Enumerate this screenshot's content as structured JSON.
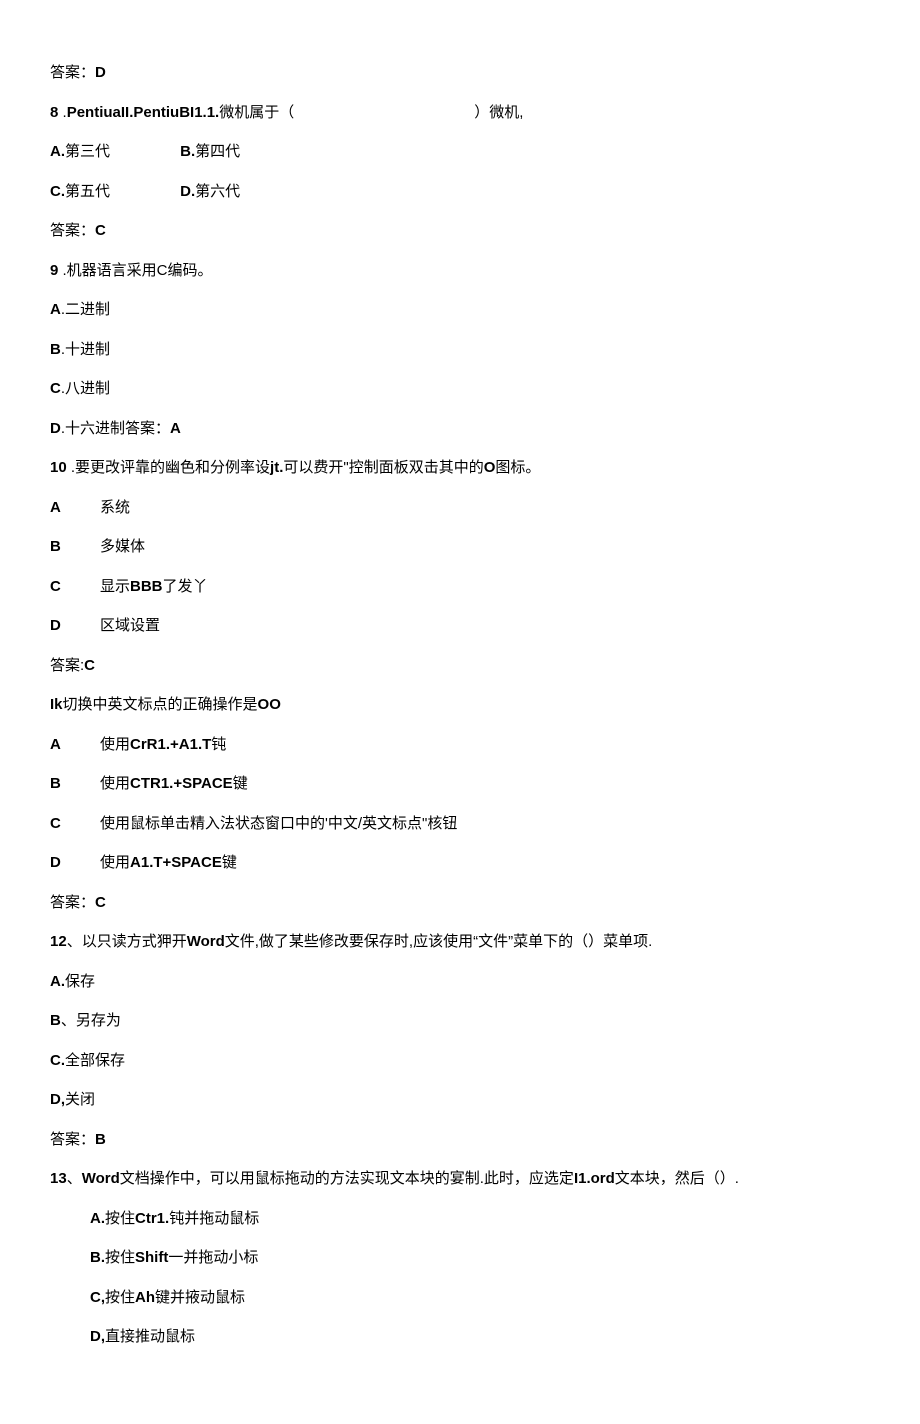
{
  "ans7": {
    "label": "答案：",
    "val": "D"
  },
  "q8": {
    "num": "8",
    "dot": " .",
    "stem_bold": "PentiuaII.PentiuBI1.1.",
    "stem_rest_1": "微机属于（",
    "stem_rest_2": "）微机,",
    "optA": {
      "label": "A.",
      "text": "第三代"
    },
    "optB": {
      "label": "B.",
      "text": "第四代"
    },
    "optC": {
      "label": "C.",
      "text": "第五代"
    },
    "optD": {
      "label": "D.",
      "text": "第六代"
    },
    "ans": {
      "label": "答案：",
      "val": "C"
    }
  },
  "q9": {
    "num": "9",
    "dot": " .机器语言采用C编码。",
    "optA": {
      "label": "A",
      "text": ".二进制"
    },
    "optB": {
      "label": "B",
      "text": ".十进制"
    },
    "optC": {
      "label": "C",
      "text": ".八进制"
    },
    "optD": {
      "label": "D",
      "text": ".十六进制答案：",
      "val": "A"
    }
  },
  "q10": {
    "num": "10",
    "stem_1": " .要更改评靠的幽色和分例率设",
    "stem_bold": "jt.",
    "stem_2": "可以费开\"控制面板双击其中的",
    "stem_bold2": "O",
    "stem_3": "图标。",
    "optA": {
      "label": "A",
      "text": "系统"
    },
    "optB": {
      "label": "B",
      "text": "多媒体"
    },
    "optC": {
      "label": "C",
      "pre": "显示",
      "bold": "BBB",
      "post": "了发丫"
    },
    "optD": {
      "label": "D",
      "text": "区域设置"
    },
    "ans": {
      "label": "答案:",
      "val": "C"
    }
  },
  "q11": {
    "stem_bold1": "Ik",
    "stem_mid": "切换中英文标点的正确操作是",
    "stem_bold2": "OO",
    "optA": {
      "label": "A",
      "pre": "使用",
      "bold": "CrR1.+A1.T",
      "post": "钝"
    },
    "optB": {
      "label": "B",
      "pre": "使用",
      "bold": "CTR1.+SPACE",
      "post": "键"
    },
    "optC": {
      "label": "C",
      "text": "使用鼠标单击精入法状态窗口中的'中文/英文标点\"核钮"
    },
    "optD": {
      "label": "D",
      "pre": "使用",
      "bold": "A1.T+SPACE",
      "post": "键"
    },
    "ans": {
      "label": "答案：",
      "val": "C"
    }
  },
  "q12": {
    "num": "12",
    "stem_1": "、以只读方式狎开",
    "stem_bold1": "Word",
    "stem_2": "文件,做了某些修改要保存时,应该使用“文件”菜单下的（）菜单项.",
    "optA": {
      "label": "A.",
      "text": "保存"
    },
    "optB": {
      "label": "B",
      "text": "、另存为"
    },
    "optC": {
      "label": "C.",
      "text": "全部保存"
    },
    "optD": {
      "label": "D,",
      "text": "关闭"
    },
    "ans": {
      "label": "答案：",
      "val": "B"
    }
  },
  "q13": {
    "num": "13",
    "stem_1": "、",
    "stem_bold1": "Word",
    "stem_2": "文档操作中，可以用鼠标拖动的方法实现文本块的宴制.此时，应选定",
    "stem_bold2": "I1.ord",
    "stem_3": "文本块，然后（）.",
    "optA": {
      "label": "A.",
      "pre": "按住",
      "bold": "Ctr1.",
      "post": "钝并拖动鼠标"
    },
    "optB": {
      "label": "B.",
      "pre": "按住",
      "bold": "Shift",
      "post": "一并拖动小标"
    },
    "optC": {
      "label": "C,",
      "pre": "按住",
      "bold": "Ah",
      "post": "键并掖动鼠标"
    },
    "optD": {
      "label": "D,",
      "text": "直接推动鼠标"
    }
  }
}
